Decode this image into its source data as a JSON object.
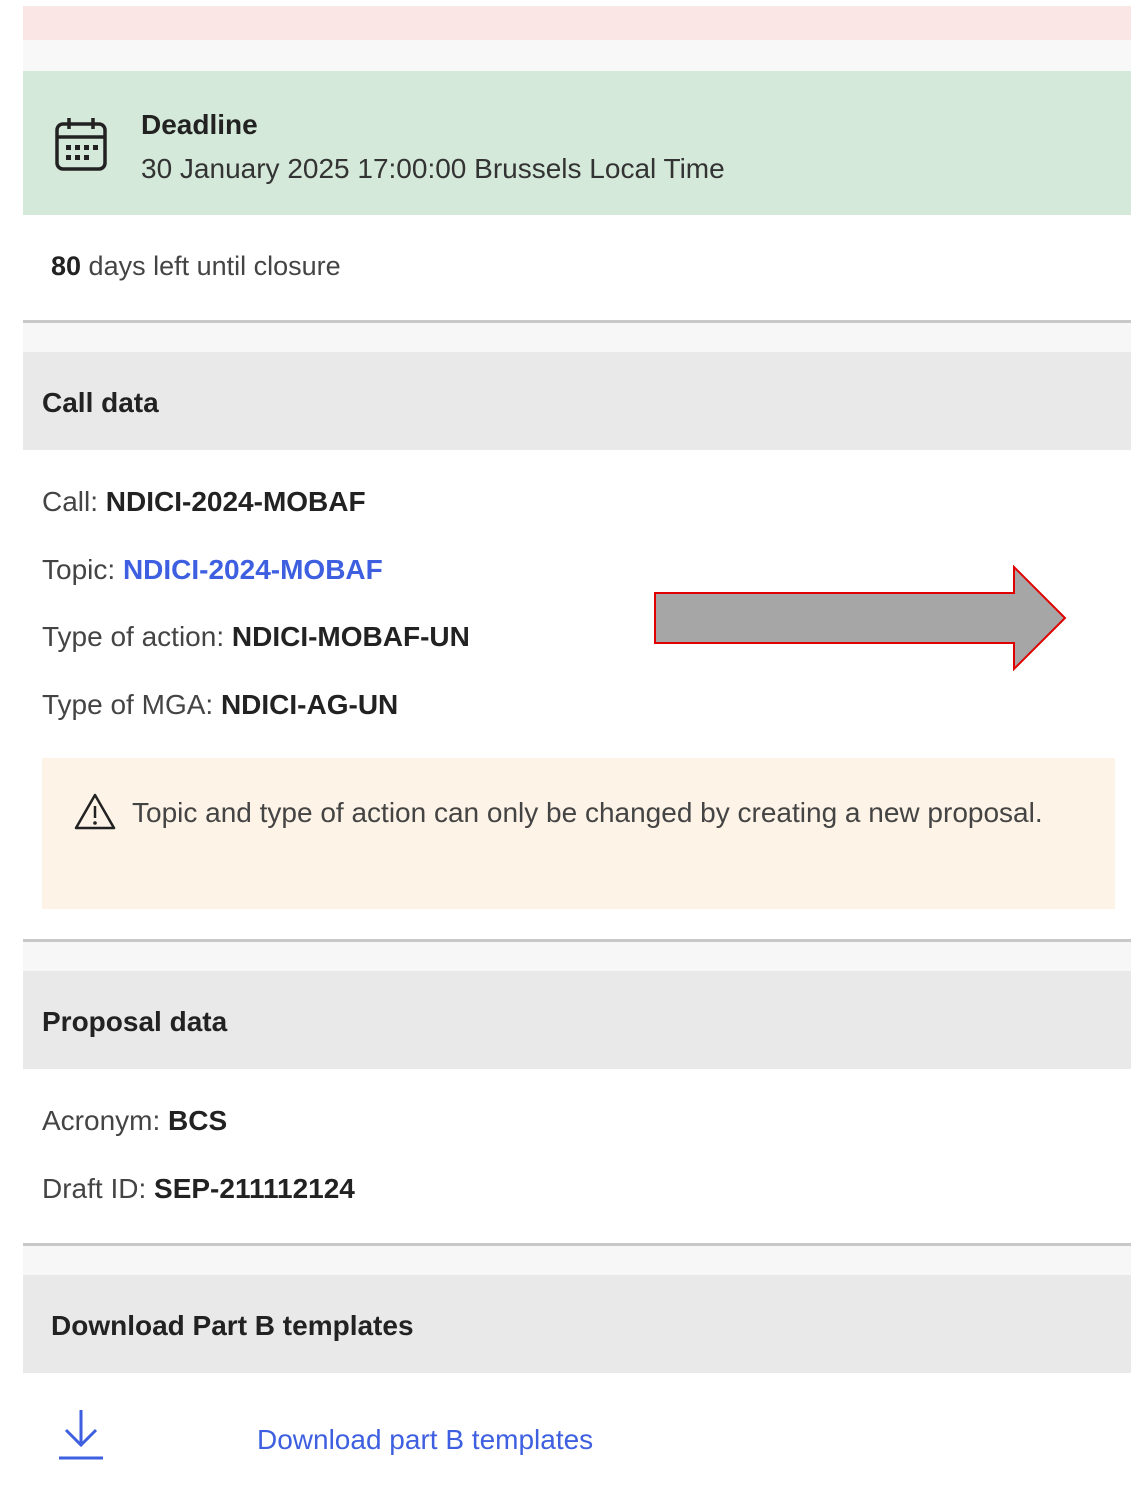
{
  "deadline": {
    "title": "Deadline",
    "date": "30 January 2025 17:00:00 Brussels Local Time",
    "icon": "calendar-icon"
  },
  "closure": {
    "days": "80",
    "suffix": " days left until closure"
  },
  "call_data": {
    "heading": "Call data",
    "call_label": "Call: ",
    "call_value": "NDICI-2024-MOBAF",
    "topic_label": "Topic:  ",
    "topic_value": "NDICI-2024-MOBAF",
    "action_label": "Type of action: ",
    "action_value": "NDICI-MOBAF-UN",
    "mga_label": "Type of MGA: ",
    "mga_value": "NDICI-AG-UN",
    "warning": "Topic and type of action can only be changed by creating a new proposal.",
    "warning_icon": "warning-icon"
  },
  "proposal_data": {
    "heading": "Proposal data",
    "acronym_label": "Acronym: ",
    "acronym_value": "BCS",
    "draft_label": "Draft ID: ",
    "draft_value": "SEP-211112124"
  },
  "templates": {
    "heading": "Download Part B templates",
    "link": "Download part B templates",
    "icon": "download-icon"
  },
  "colors": {
    "deadline_bg": "#d4e9d9",
    "warning_bg": "#fdf3e6",
    "link": "#3d5fe0",
    "arrow_fill": "#a6a6a6",
    "arrow_stroke": "#e00000"
  }
}
